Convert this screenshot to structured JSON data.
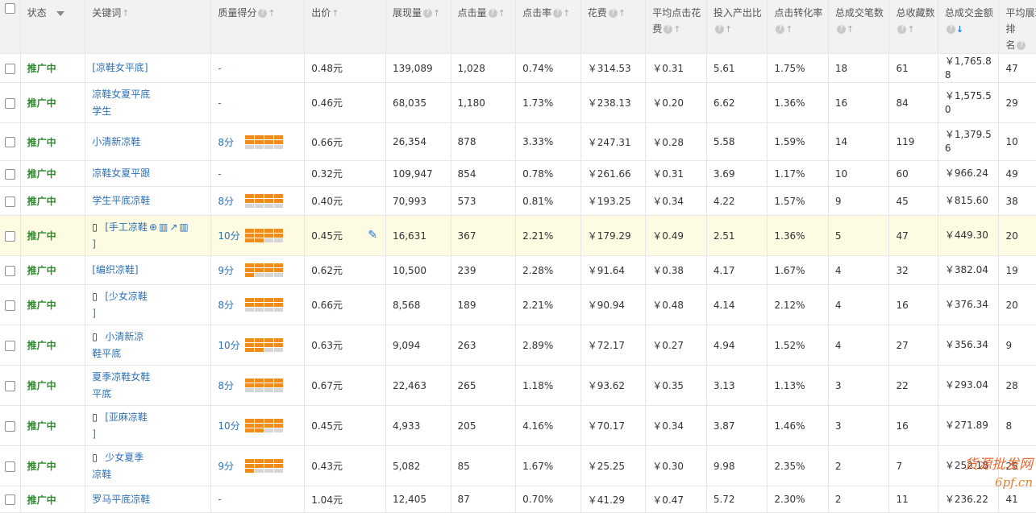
{
  "headers": {
    "status": "状态",
    "keyword": "关键词",
    "quality": "质量得分",
    "bid": "出价",
    "impressions": "展现量",
    "clicks": "点击量",
    "ctr": "点击率",
    "cost": "花费",
    "avg_cpc_1": "平均点击花",
    "avg_cpc_2": "费",
    "roi": "投入产出比",
    "cvr": "点击转化率",
    "orders": "总成交笔数",
    "favorites": "总收藏数",
    "gmv": "总成交金额",
    "rank_1": "平均展现排",
    "rank_2": "名"
  },
  "help_mark": "?",
  "rows": [
    {
      "status": "推广中",
      "kw_line1": "[凉鞋女平底]",
      "kw_line2": "",
      "mobile": false,
      "actions": false,
      "quality_text": "-",
      "quality_level": 0,
      "bid": "0.48元",
      "impressions": "139,089",
      "clicks": "1,028",
      "ctr": "0.74%",
      "cost": "￥314.53",
      "cpc": "￥0.31",
      "roi": "5.61",
      "cvr": "1.75%",
      "orders": "18",
      "favorites": "61",
      "gmv_line1": "￥1,765.8",
      "gmv_line2": "8",
      "rank": "47"
    },
    {
      "status": "推广中",
      "kw_line1": "凉鞋女夏平底",
      "kw_line2": "学生",
      "mobile": false,
      "actions": false,
      "quality_text": "-",
      "quality_level": 0,
      "bid": "0.46元",
      "impressions": "68,035",
      "clicks": "1,180",
      "ctr": "1.73%",
      "cost": "￥238.13",
      "cpc": "￥0.20",
      "roi": "6.62",
      "cvr": "1.36%",
      "orders": "16",
      "favorites": "84",
      "gmv_line1": "￥1,575.5",
      "gmv_line2": "0",
      "rank": "29"
    },
    {
      "status": "推广中",
      "kw_line1": "小清新凉鞋",
      "kw_line2": "",
      "mobile": false,
      "actions": false,
      "quality_text": "8分",
      "quality_level": 8,
      "bid": "0.66元",
      "impressions": "26,354",
      "clicks": "878",
      "ctr": "3.33%",
      "cost": "￥247.31",
      "cpc": "￥0.28",
      "roi": "5.58",
      "cvr": "1.59%",
      "orders": "14",
      "favorites": "119",
      "gmv_line1": "￥1,379.5",
      "gmv_line2": "6",
      "rank": "10"
    },
    {
      "status": "推广中",
      "kw_line1": "凉鞋女夏平跟",
      "kw_line2": "",
      "mobile": false,
      "actions": false,
      "quality_text": "-",
      "quality_level": 0,
      "bid": "0.32元",
      "impressions": "109,947",
      "clicks": "854",
      "ctr": "0.78%",
      "cost": "￥261.66",
      "cpc": "￥0.31",
      "roi": "3.69",
      "cvr": "1.17%",
      "orders": "10",
      "favorites": "60",
      "gmv_line1": "￥966.24",
      "gmv_line2": "",
      "rank": "49"
    },
    {
      "status": "推广中",
      "kw_line1": "学生平底凉鞋",
      "kw_line2": "",
      "mobile": false,
      "actions": false,
      "quality_text": "8分",
      "quality_level": 8,
      "bid": "0.40元",
      "impressions": "70,993",
      "clicks": "573",
      "ctr": "0.81%",
      "cost": "￥193.25",
      "cpc": "￥0.34",
      "roi": "4.22",
      "cvr": "1.57%",
      "orders": "9",
      "favorites": "45",
      "gmv_line1": "￥815.60",
      "gmv_line2": "",
      "rank": "38"
    },
    {
      "status": "推广中",
      "kw_line1": "[手工凉鞋",
      "kw_line2": "]",
      "mobile": true,
      "actions": true,
      "quality_text": "10分",
      "quality_level": 10,
      "bid": "0.45元",
      "impressions": "16,631",
      "clicks": "367",
      "ctr": "2.21%",
      "cost": "￥179.29",
      "cpc": "￥0.49",
      "roi": "2.51",
      "cvr": "1.36%",
      "orders": "5",
      "favorites": "47",
      "gmv_line1": "￥449.30",
      "gmv_line2": "",
      "rank": "20"
    },
    {
      "status": "推广中",
      "kw_line1": "[编织凉鞋]",
      "kw_line2": "",
      "mobile": false,
      "actions": false,
      "quality_text": "9分",
      "quality_level": 9,
      "bid": "0.62元",
      "impressions": "10,500",
      "clicks": "239",
      "ctr": "2.28%",
      "cost": "￥91.64",
      "cpc": "￥0.38",
      "roi": "4.17",
      "cvr": "1.67%",
      "orders": "4",
      "favorites": "32",
      "gmv_line1": "￥382.04",
      "gmv_line2": "",
      "rank": "19"
    },
    {
      "status": "推广中",
      "kw_line1": "[少女凉鞋",
      "kw_line2": "]",
      "mobile": true,
      "actions": false,
      "quality_text": "8分",
      "quality_level": 8,
      "bid": "0.66元",
      "impressions": "8,568",
      "clicks": "189",
      "ctr": "2.21%",
      "cost": "￥90.94",
      "cpc": "￥0.48",
      "roi": "4.14",
      "cvr": "2.12%",
      "orders": "4",
      "favorites": "16",
      "gmv_line1": "￥376.34",
      "gmv_line2": "",
      "rank": "20"
    },
    {
      "status": "推广中",
      "kw_line1": "小清新凉",
      "kw_line2": "鞋平底",
      "mobile": true,
      "actions": false,
      "quality_text": "10分",
      "quality_level": 10,
      "bid": "0.63元",
      "impressions": "9,094",
      "clicks": "263",
      "ctr": "2.89%",
      "cost": "￥72.17",
      "cpc": "￥0.27",
      "roi": "4.94",
      "cvr": "1.52%",
      "orders": "4",
      "favorites": "27",
      "gmv_line1": "￥356.34",
      "gmv_line2": "",
      "rank": "9"
    },
    {
      "status": "推广中",
      "kw_line1": "夏季凉鞋女鞋",
      "kw_line2": "平底",
      "mobile": false,
      "actions": false,
      "quality_text": "8分",
      "quality_level": 8,
      "bid": "0.67元",
      "impressions": "22,463",
      "clicks": "265",
      "ctr": "1.18%",
      "cost": "￥93.62",
      "cpc": "￥0.35",
      "roi": "3.13",
      "cvr": "1.13%",
      "orders": "3",
      "favorites": "22",
      "gmv_line1": "￥293.04",
      "gmv_line2": "",
      "rank": "28"
    },
    {
      "status": "推广中",
      "kw_line1": "[亚麻凉鞋",
      "kw_line2": "]",
      "mobile": true,
      "actions": false,
      "quality_text": "10分",
      "quality_level": 10,
      "bid": "0.45元",
      "impressions": "4,933",
      "clicks": "205",
      "ctr": "4.16%",
      "cost": "￥70.17",
      "cpc": "￥0.34",
      "roi": "3.87",
      "cvr": "1.46%",
      "orders": "3",
      "favorites": "16",
      "gmv_line1": "￥271.89",
      "gmv_line2": "",
      "rank": "8"
    },
    {
      "status": "推广中",
      "kw_line1": "少女夏季",
      "kw_line2": "凉鞋",
      "mobile": true,
      "actions": false,
      "quality_text": "9分",
      "quality_level": 9,
      "bid": "0.43元",
      "impressions": "5,082",
      "clicks": "85",
      "ctr": "1.67%",
      "cost": "￥25.25",
      "cpc": "￥0.30",
      "roi": "9.98",
      "cvr": "2.35%",
      "orders": "2",
      "favorites": "7",
      "gmv_line1": "￥252.18",
      "gmv_line2": "",
      "rank": "25"
    },
    {
      "status": "推广中",
      "kw_line1": "罗马平底凉鞋",
      "kw_line2": "",
      "mobile": false,
      "actions": false,
      "quality_text": "-",
      "quality_level": 0,
      "bid": "1.04元",
      "impressions": "12,405",
      "clicks": "87",
      "ctr": "0.70%",
      "cost": "￥41.29",
      "cpc": "￥0.47",
      "roi": "5.72",
      "cvr": "2.30%",
      "orders": "2",
      "favorites": "11",
      "gmv_line1": "￥236.22",
      "gmv_line2": "",
      "rank": "41"
    }
  ],
  "watermark": {
    "line1": "货源批发网",
    "line2": "6pf.cn"
  },
  "colors": {
    "status": "#2d8b2d",
    "link": "#2f72b8",
    "bar_on": "#f08c1e",
    "bar_off": "#d6d6d6",
    "highlight_row": "#fdfbe1"
  }
}
